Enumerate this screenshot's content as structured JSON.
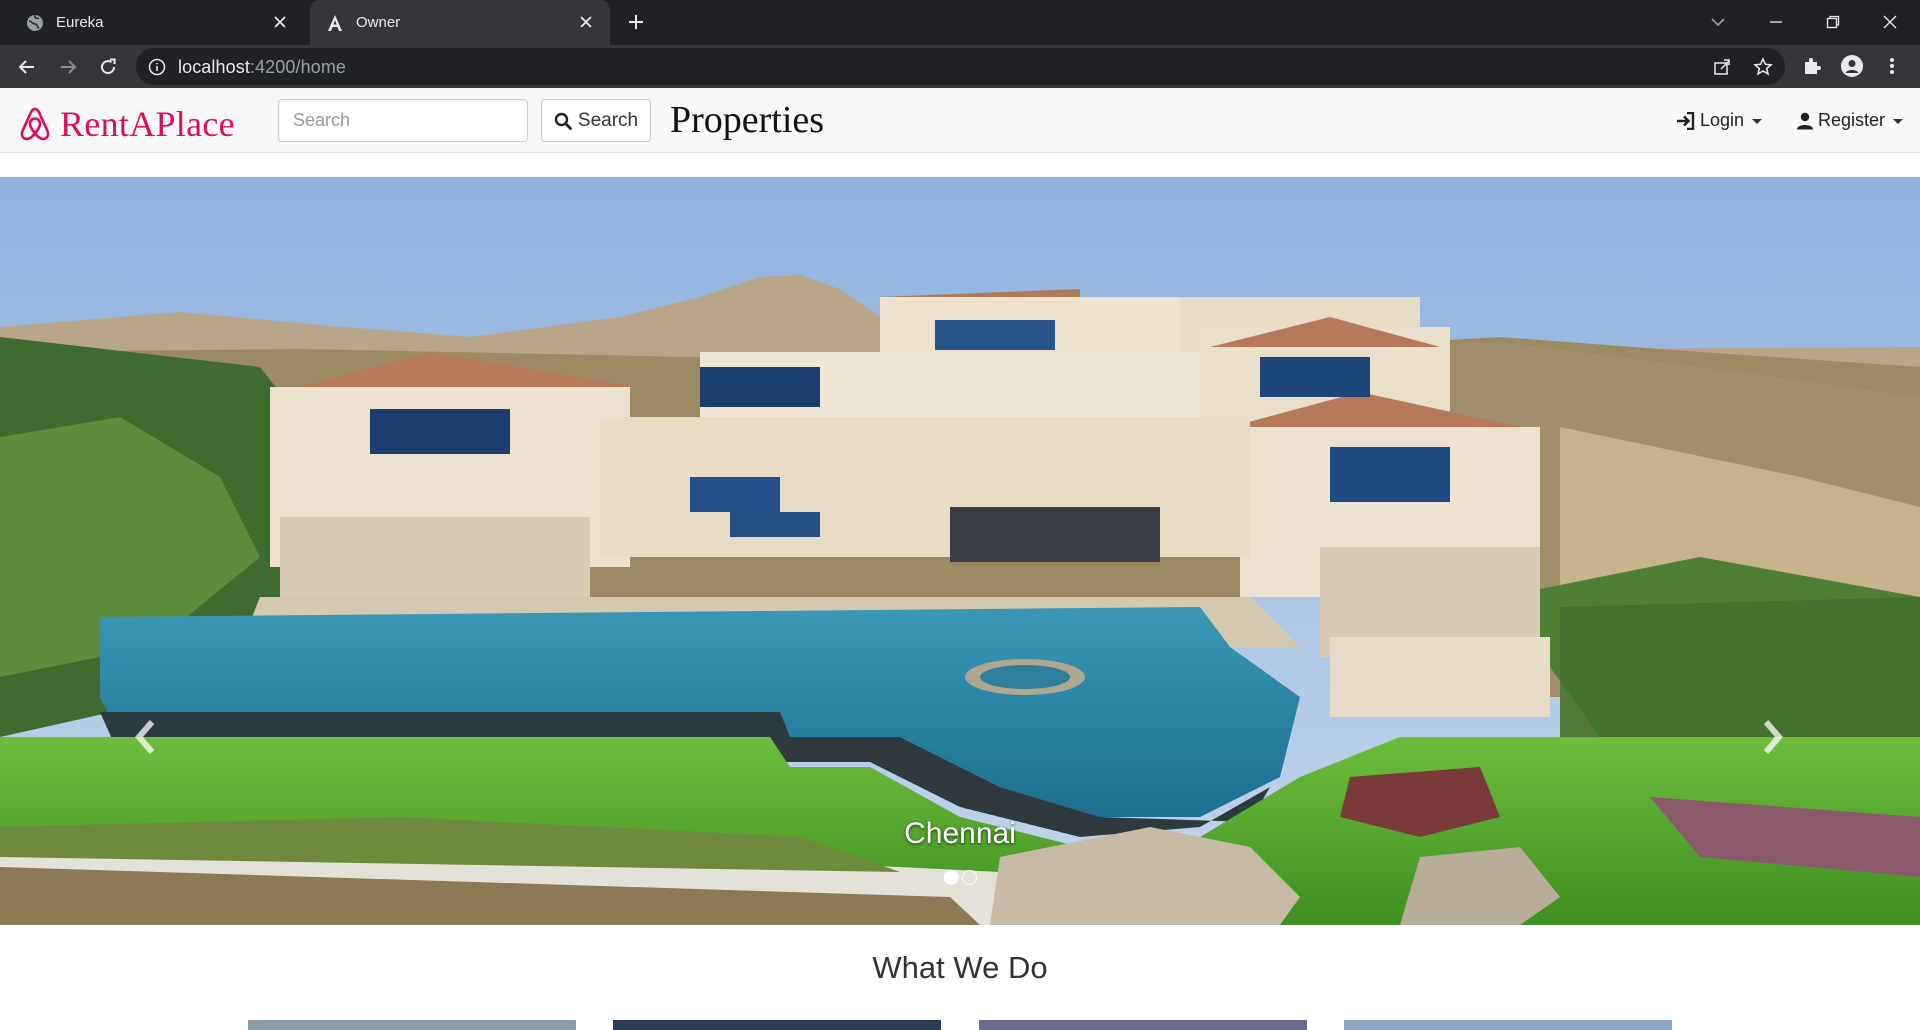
{
  "browser": {
    "tabs": [
      {
        "title": "Eureka",
        "active": false
      },
      {
        "title": "Owner",
        "active": true
      }
    ],
    "url_host": "localhost",
    "url_path": ":4200/home"
  },
  "navbar": {
    "brand": "RentAPlace",
    "search_placeholder": "Search",
    "search_button": "Search",
    "page_heading": "Properties",
    "login_label": "Login",
    "register_label": "Register"
  },
  "carousel": {
    "caption": "Chennai",
    "slide_count": 2,
    "active_slide": 1
  },
  "section": {
    "title": "What We Do"
  },
  "colors": {
    "brand": "#e00b5a",
    "chrome_dark": "#202124",
    "chrome_tab": "#35363a",
    "navbar_bg": "#f8f8f8"
  },
  "icons": [
    "globe-icon",
    "angular-icon",
    "close-icon",
    "plus-icon",
    "back-icon",
    "forward-icon",
    "reload-icon",
    "info-icon",
    "share-icon",
    "star-icon",
    "puzzle-icon",
    "profile-icon",
    "kebab-icon",
    "search-icon",
    "login-icon",
    "user-icon",
    "chevron-left-icon",
    "chevron-right-icon"
  ]
}
